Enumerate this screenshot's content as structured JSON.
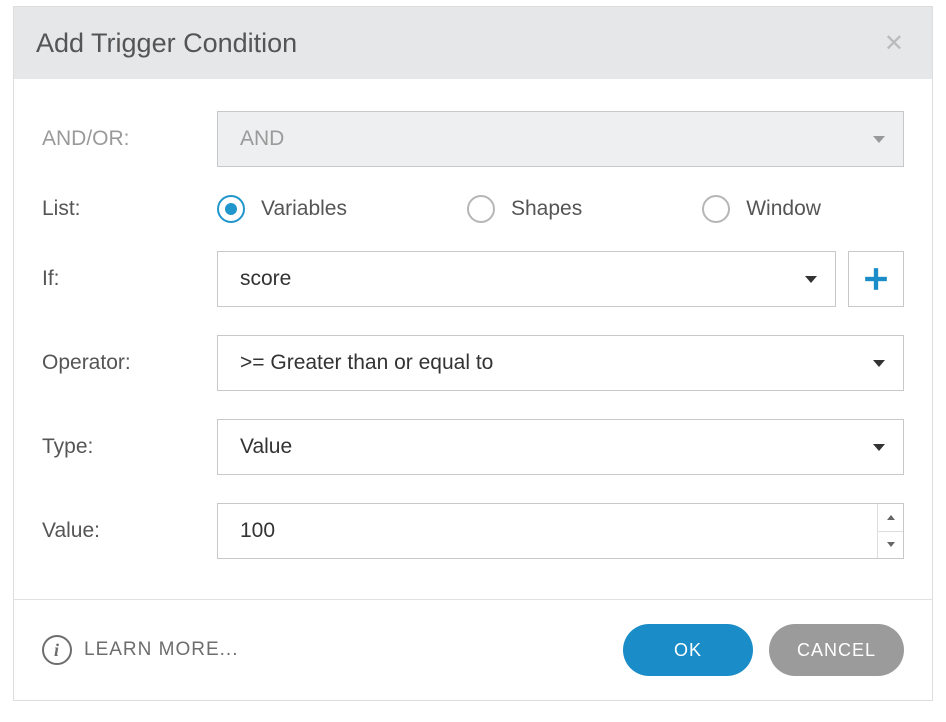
{
  "dialog": {
    "title": "Add Trigger Condition"
  },
  "labels": {
    "and_or": "AND/OR:",
    "list": "List:",
    "if": "If:",
    "operator": "Operator:",
    "type": "Type:",
    "value": "Value:"
  },
  "fields": {
    "and_or": {
      "value": "AND",
      "disabled": true
    },
    "list": {
      "options": [
        "Variables",
        "Shapes",
        "Window"
      ],
      "selected": "Variables"
    },
    "if": {
      "value": "score"
    },
    "operator": {
      "value": ">= Greater than or equal to"
    },
    "type": {
      "value": "Value"
    },
    "value_input": {
      "value": "100"
    }
  },
  "footer": {
    "learn_more": "LEARN MORE...",
    "ok": "OK",
    "cancel": "CANCEL"
  }
}
